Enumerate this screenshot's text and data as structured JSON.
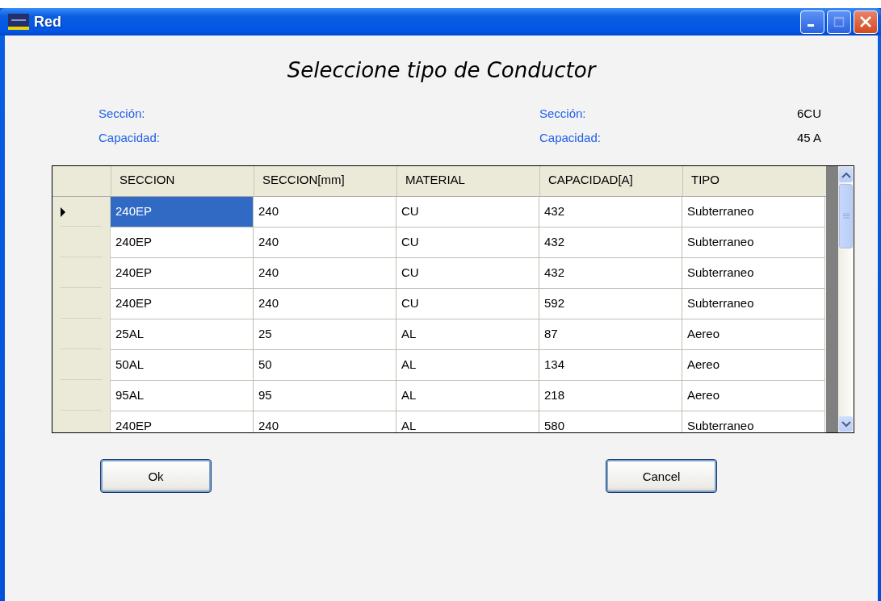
{
  "window": {
    "title": "Red"
  },
  "heading": "Seleccione tipo de Conductor",
  "info_left": [
    {
      "label": "Sección:"
    },
    {
      "label": "Capacidad:"
    }
  ],
  "info_right": [
    {
      "label": "Sección:",
      "value": "6CU"
    },
    {
      "label": "Capacidad:",
      "value": "45 A"
    }
  ],
  "table": {
    "columns": [
      "SECCION",
      "SECCION[mm]",
      "MATERIAL",
      "CAPACIDAD[A]",
      "TIPO"
    ],
    "rows": [
      {
        "selected": true,
        "cells": [
          "240EP",
          "240",
          "CU",
          "432",
          "Subterraneo"
        ]
      },
      {
        "selected": false,
        "cells": [
          "240EP",
          "240",
          "CU",
          "432",
          "Subterraneo"
        ]
      },
      {
        "selected": false,
        "cells": [
          "240EP",
          "240",
          "CU",
          "432",
          "Subterraneo"
        ]
      },
      {
        "selected": false,
        "cells": [
          "240EP",
          "240",
          "CU",
          "592",
          "Subterraneo"
        ]
      },
      {
        "selected": false,
        "cells": [
          "25AL",
          "25",
          "AL",
          "87",
          "Aereo"
        ]
      },
      {
        "selected": false,
        "cells": [
          "50AL",
          "50",
          "AL",
          "134",
          "Aereo"
        ]
      },
      {
        "selected": false,
        "cells": [
          "95AL",
          "95",
          "AL",
          "218",
          "Aereo"
        ]
      },
      {
        "selected": false,
        "cells": [
          "240EP",
          "240",
          "AL",
          "580",
          "Subterraneo"
        ]
      }
    ]
  },
  "buttons": [
    "Ok",
    "Cancel"
  ]
}
